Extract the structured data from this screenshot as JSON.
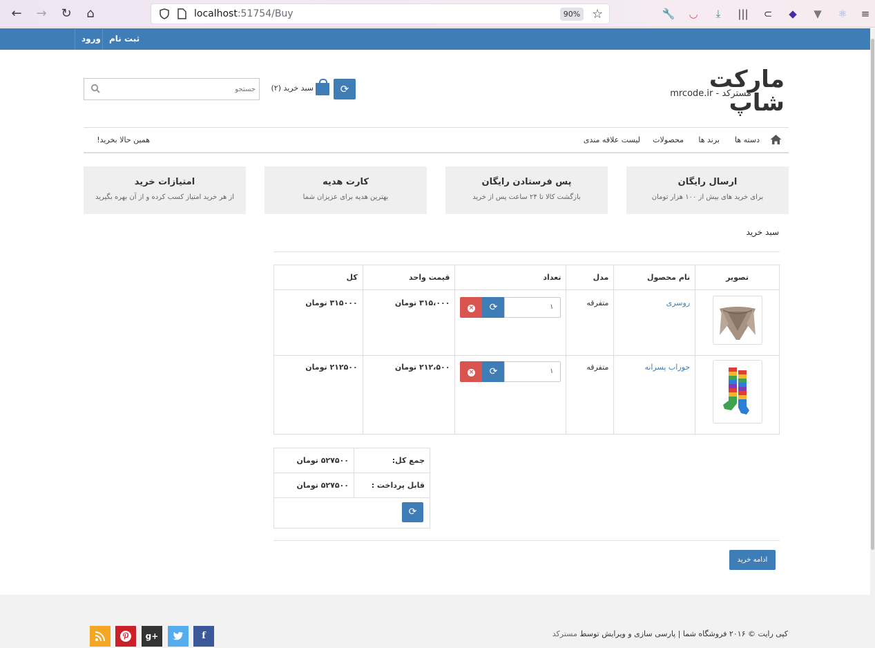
{
  "browser": {
    "url_host": "localhost",
    "url_path": ":51754/Buy",
    "zoom": "90%"
  },
  "topbar": {
    "login": "ورود",
    "register": "ثبت نام"
  },
  "header": {
    "logo_main": "مارکت شاپ",
    "logo_sub": "مسترکد - mrcode.ir",
    "cart_label": "سبد خرید (۲)",
    "search_placeholder": "جستجو"
  },
  "nav": {
    "categories": "دسته ها",
    "brands": "برند ها",
    "products": "محصولات",
    "wishlist": "لیست علاقه مندی",
    "buy_now": "همین حالا بخرید!"
  },
  "features": [
    {
      "title": "ارسال رایگان",
      "text": "برای خرید های بیش از ۱۰۰ هزار تومان"
    },
    {
      "title": "پس فرستادن رایگان",
      "text": "بازگشت کالا تا ۲۴ ساعت پس از خرید"
    },
    {
      "title": "کارت هدیه",
      "text": "بهترین هدیه برای عزیزان شما"
    },
    {
      "title": "امتیازات خرید",
      "text": "از هر خرید امتیاز کسب کرده و از آن بهره بگیرید"
    }
  ],
  "cart": {
    "heading": "سبد خرید",
    "columns": [
      "تصویر",
      "نام محصول",
      "مدل",
      "تعداد",
      "قیمت واحد",
      "کل"
    ],
    "rows": [
      {
        "name": "روسری",
        "model": "متفرقه",
        "qty": "۱",
        "unit_price": "۳۱۵،۰۰۰ تومان",
        "total": "۳۱۵۰۰۰ تومان"
      },
      {
        "name": "جوراب پسرانه",
        "model": "متفرقه",
        "qty": "۱",
        "unit_price": "۲۱۲،۵۰۰ تومان",
        "total": "۲۱۲۵۰۰ تومان"
      }
    ],
    "subtotal_label": "جمع کل:",
    "subtotal_value": "۵۲۷۵۰۰ تومان",
    "payable_label": "قابل پرداخت :",
    "payable_value": "۵۲۷۵۰۰ تومان",
    "continue_label": "ادامه خرید"
  },
  "footer": {
    "copyright": "کپی رایت © ۲۰۱۶ فروشگاه شما | پارسی سازی و ویرایش توسط ",
    "brand": "مسترکد",
    "social": [
      {
        "name": "facebook",
        "glyph": "f",
        "color": "#3b5998"
      },
      {
        "name": "twitter",
        "glyph": "t",
        "color": "#55acee"
      },
      {
        "name": "google-plus",
        "glyph": "g+",
        "color": "#333333"
      },
      {
        "name": "pinterest",
        "glyph": "P",
        "color": "#cb2027"
      },
      {
        "name": "rss",
        "glyph": "rss",
        "color": "#f5a623"
      }
    ]
  },
  "colors": {
    "primary": "#3f7db7",
    "danger": "#d9534f",
    "feature_bg": "#efefef"
  }
}
